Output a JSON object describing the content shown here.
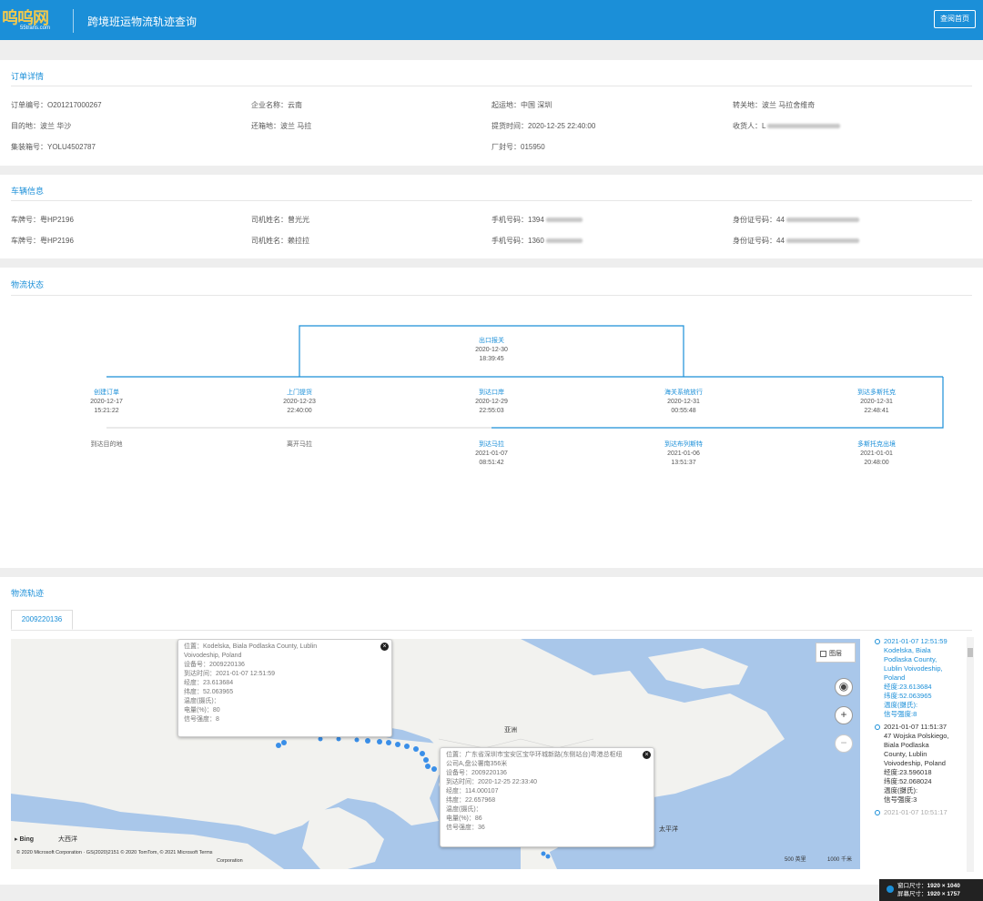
{
  "header": {
    "logo": "呜呜网",
    "logo_sub": "55trans.com",
    "title": "跨境班运物流轨迹查询",
    "button": "查阅首页"
  },
  "order": {
    "title": "订单详情",
    "fields": [
      "订单编号：O201217000267",
      "企业名称：云南",
      "起运地：中国 深圳",
      "转关地：波兰 马拉舍维奇",
      "目的地：波兰 华沙",
      "还箱地：波兰 马拉",
      "提货时间：2020-12-25 22:40:00",
      "收货人：L",
      "集装箱号：YOLU4502787",
      "",
      "厂封号：015950",
      ""
    ]
  },
  "vehicle": {
    "title": "车辆信息",
    "rows": [
      [
        "车牌号：粤HP2196",
        "司机姓名：曾光光",
        "手机号码：1394",
        "身份证号码：44"
      ],
      [
        "车牌号：粤HP2196",
        "司机姓名：赖拉拉",
        "手机号码：1360",
        "身份证号码：44"
      ]
    ]
  },
  "status": {
    "title": "物流状态",
    "top": {
      "label": "出口报关",
      "date": "2020-12-30",
      "time": "18:39:45"
    },
    "row1": [
      {
        "label": "创建订单",
        "date": "2020-12-17",
        "time": "15:21:22"
      },
      {
        "label": "上门提货",
        "date": "2020-12-23",
        "time": "22:40:00"
      },
      {
        "label": "到达口岸",
        "date": "2020-12-29",
        "time": "22:55:03"
      },
      {
        "label": "海关系统放行",
        "date": "2020-12-31",
        "time": "00:55:48"
      },
      {
        "label": "到达多斯托克",
        "date": "2020-12-31",
        "time": "22:48:41"
      }
    ],
    "row2": [
      {
        "label": "到达目的地",
        "date": "",
        "time": ""
      },
      {
        "label": "离开马拉",
        "date": "",
        "time": ""
      },
      {
        "label": "到达马拉",
        "date": "2021-01-07",
        "time": "08:51:42"
      },
      {
        "label": "到达布列斯特",
        "date": "2021-01-06",
        "time": "13:51:37"
      },
      {
        "label": "多斯托克出境",
        "date": "2021-01-01",
        "time": "20:48:00"
      }
    ]
  },
  "track": {
    "title": "物流轨迹",
    "tab": "2009220136",
    "popup1": [
      "位置：Kodelska, Biala Podlaska County, Lublin",
      "Voivodeship, Poland",
      "设备号：2009220136",
      "到达时间：2021-01-07 12:51:59",
      "经度：23.613684",
      "纬度：52.063965",
      "温度(摄氏)：",
      "电量(%)：80",
      "信号强度：8"
    ],
    "popup2": [
      "位置：广东省深圳市宝安区宝华环城新路(东侧站台)粤港总枢纽",
      "公司A,盘公署南356米",
      "设备号：2009220136",
      "到达时间：2020-12-25 22:33:40",
      "经度：114.000107",
      "纬度：22.657968",
      "温度(摄氏)：",
      "电量(%)：86",
      "信号强度：36"
    ],
    "map_labels": {
      "asia": "亚洲",
      "pacific": "太平洋",
      "atlantic": "大西洋",
      "layer": "图层",
      "bing": "Bing",
      "scale1": "500 英里",
      "scale2": "1000 千米"
    },
    "copyright": "© 2020 Microsoft Corporation  · GS(2020)2151  © 2020 TomTom, © 2021 Microsoft Terms",
    "copyright2": "Corporation",
    "side": [
      {
        "time": "2021-01-07 12:51:59",
        "lines": [
          "Kodelska, Biala",
          "Podlaska County,",
          "Lublin Voivodeship,",
          "Poland",
          "经度:23.613684",
          "纬度:52.063965",
          "温度(摄氏):",
          "信号强度:8"
        ]
      },
      {
        "time": "2021-01-07 11:51:37",
        "lines": [
          "47 Wojska Polskiego,",
          "Biala Podlaska",
          "County, Lublin",
          "Voivodeship, Poland",
          "经度:23.596018",
          "纬度:52.068024",
          "温度(摄氏):",
          "信号强度:3"
        ]
      },
      {
        "time": "2021-01-07 10:51:17",
        "lines": []
      }
    ]
  },
  "status_bar": {
    "r1_label": "窗口尺寸：",
    "r1_value": "1920 × 1040",
    "r2_label": "屏幕尺寸：",
    "r2_value": "1920 × 1757"
  }
}
